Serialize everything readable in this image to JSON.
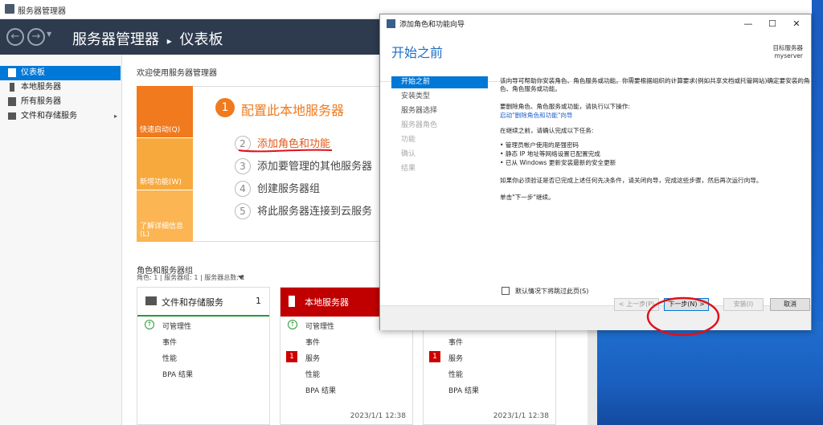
{
  "main_window": {
    "title": "服务器管理器",
    "breadcrumb_app": "服务器管理器",
    "breadcrumb_sep": "▸",
    "breadcrumb_page": "仪表板"
  },
  "sidebar": {
    "items": [
      {
        "label": "仪表板",
        "active": true
      },
      {
        "label": "本地服务器"
      },
      {
        "label": "所有服务器"
      },
      {
        "label": "文件和存储服务",
        "has_arrow": true
      }
    ],
    "arrow": "▸"
  },
  "dashboard": {
    "welcome": "欢迎使用服务器管理器",
    "tiles": [
      "快速启动(Q)",
      "新增功能(W)",
      "了解详细信息(L)"
    ],
    "step1_num": "1",
    "step1": "配置此本地服务器",
    "steps": [
      {
        "num": "2",
        "label": "添加角色和功能"
      },
      {
        "num": "3",
        "label": "添加要管理的其他服务器"
      },
      {
        "num": "4",
        "label": "创建服务器组"
      },
      {
        "num": "5",
        "label": "将此服务器连接到云服务"
      }
    ],
    "roles_title": "角色和服务器组",
    "roles_sub": "角色: 1 | 服务器组: 1 | 服务器总数: 1",
    "cards": [
      {
        "title": "文件和存储服务",
        "count": "1",
        "rows": [
          "可管理性",
          "事件",
          "性能",
          "BPA 结果"
        ]
      },
      {
        "title": "本地服务器",
        "count": "1",
        "rows": [
          "可管理性",
          "事件",
          "服务",
          "性能",
          "BPA 结果"
        ],
        "badge": "1",
        "timestamp": "2023/1/1 12:38"
      },
      {
        "rows": [
          "事件",
          "服务",
          "性能",
          "BPA 结果"
        ],
        "badge": "1",
        "timestamp": "2023/1/1 12:38"
      }
    ]
  },
  "wizard": {
    "title": "添加角色和功能向导",
    "heading": "开始之前",
    "target_label": "目标服务器",
    "target_value": "myserver",
    "nav": [
      "开始之前",
      "安装类型",
      "服务器选择",
      "服务器角色",
      "功能",
      "确认",
      "结果"
    ],
    "p1": "该向导可帮助你安装角色、角色服务或功能。你需要根据组织的计算要求(例如共享文档或托管网站)确定要安装的角色、角色服务或功能。",
    "p2": "要删除角色、角色服务或功能，请执行以下操作:",
    "link": "启动\"删除角色和功能\"向导",
    "p3": "在继续之前，请确认完成以下任务:",
    "bullets": [
      "• 管理员帐户使用的是强密码",
      "• 静态 IP 地址等网络设置已配置完成",
      "• 已从 Windows 更新安装最新的安全更新"
    ],
    "p4": "如果你必须验证是否已完成上述任何先决条件，请关闭向导，完成这些步骤，然后再次运行向导。",
    "p5": "单击\"下一步\"继续。",
    "skip": "默认情况下将跳过此页(S)",
    "buttons": {
      "prev": "< 上一步(P)",
      "next": "下一步(N) >",
      "install": "安装(I)",
      "cancel": "取消"
    },
    "window_controls": {
      "min": "—",
      "max": "☐",
      "close": "✕"
    }
  },
  "colors": {
    "accent": "#0078d7",
    "orange": "#f07a1d",
    "header": "#2e3b4e",
    "badge": "#c00000",
    "annotation": "#e0101a"
  }
}
